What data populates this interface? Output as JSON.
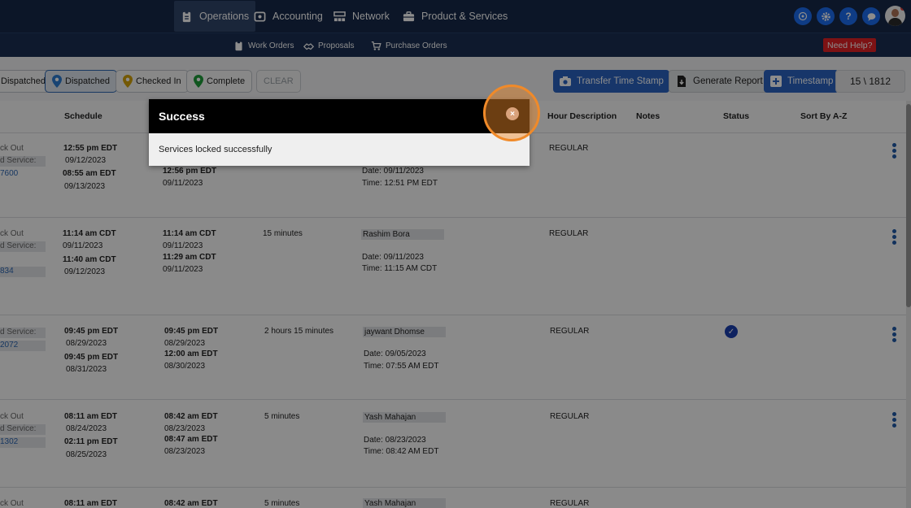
{
  "nav": {
    "items": [
      {
        "label": "Operations",
        "icon": "clipboard-icon"
      },
      {
        "label": "Accounting",
        "icon": "money-icon"
      },
      {
        "label": "Network",
        "icon": "network-icon"
      },
      {
        "label": "Product & Services",
        "icon": "briefcase-icon"
      }
    ],
    "right_icons": [
      "compass-icon",
      "gear-icon",
      "help-icon",
      "chat-icon"
    ],
    "help_glyph": "?"
  },
  "subnav": {
    "items": [
      {
        "label": "Work Orders",
        "icon": "clipboard-icon"
      },
      {
        "label": "Proposals",
        "icon": "handshake-icon"
      },
      {
        "label": "Purchase Orders",
        "icon": "cart-icon"
      }
    ],
    "help_label": "Need Help?"
  },
  "toolbar": {
    "filters": [
      {
        "label": "Dispatched",
        "pin_color": "#9aa3ad"
      },
      {
        "label": "Dispatched",
        "pin_color": "#2d7dd2"
      },
      {
        "label": "Checked In",
        "pin_color": "#d4a20a"
      },
      {
        "label": "Complete",
        "pin_color": "#1e9d3a"
      }
    ],
    "clear_label": "CLEAR",
    "transfer_label": "Transfer Time Stamp",
    "report_label": "Generate Report",
    "timestamp_label": "Timestamp",
    "counter": "15 \\ 1812"
  },
  "table": {
    "headers": {
      "schedule": "Schedule",
      "hour_description": "Hour Description",
      "notes": "Notes",
      "status": "Status",
      "sort": "Sort By A-Z"
    },
    "rows": [
      {
        "left": [
          "ck Out",
          "d Service:",
          "7600"
        ],
        "sched_start": "12:55 pm EDT",
        "sched_start_date": "09/12/2023",
        "sched_end": "08:55 am EDT",
        "sched_end_date": "09/13/2023",
        "act_start": "",
        "act_start_date": "",
        "act_end": "12:56 pm EDT",
        "act_end_date": "09/11/2023",
        "duration": "",
        "tech": "",
        "date": "Date: 09/11/2023",
        "time": "Time: 12:51 PM EDT",
        "hour": "REGULAR",
        "status_checked": false
      },
      {
        "left": [
          "ck Out",
          "d Service:",
          "834"
        ],
        "sched_start": "11:14 am CDT",
        "sched_start_date": "09/11/2023",
        "sched_end": "11:40 am CDT",
        "sched_end_date": "09/12/2023",
        "act_start": "11:14 am CDT",
        "act_start_date": "09/11/2023",
        "act_end": "11:29 am CDT",
        "act_end_date": "09/11/2023",
        "duration": "15 minutes",
        "tech": "Rashim Bora",
        "date": "Date: 09/11/2023",
        "time": "Time: 11:15 AM CDT",
        "hour": "REGULAR",
        "status_checked": false
      },
      {
        "left": [
          "",
          "d Service:",
          "2072"
        ],
        "sched_start": "09:45 pm EDT",
        "sched_start_date": "08/29/2023",
        "sched_end": "09:45 pm EDT",
        "sched_end_date": "08/31/2023",
        "act_start": "09:45 pm EDT",
        "act_start_date": "08/29/2023",
        "act_end": "12:00 am EDT",
        "act_end_date": "08/30/2023",
        "duration": "2 hours 15 minutes",
        "tech": "jaywant Dhomse",
        "date": "Date: 09/05/2023",
        "time": "Time: 07:55 AM EDT",
        "hour": "REGULAR",
        "status_checked": true
      },
      {
        "left": [
          "ck Out",
          "d Service:",
          "1302"
        ],
        "sched_start": "08:11 am EDT",
        "sched_start_date": "08/24/2023",
        "sched_end": "02:11 pm EDT",
        "sched_end_date": "08/25/2023",
        "act_start": "08:42 am EDT",
        "act_start_date": "08/23/2023",
        "act_end": "08:47 am EDT",
        "act_end_date": "08/23/2023",
        "duration": "5 minutes",
        "tech": "Yash Mahajan",
        "date": "Date: 08/23/2023",
        "time": "Time: 08:42 AM EDT",
        "hour": "REGULAR",
        "status_checked": false
      },
      {
        "left": [
          "ck Out",
          "",
          ""
        ],
        "sched_start": "08:11 am EDT",
        "sched_start_date": "",
        "sched_end": "",
        "sched_end_date": "",
        "act_start": "08:42 am EDT",
        "act_start_date": "",
        "act_end": "",
        "act_end_date": "",
        "duration": "5 minutes",
        "tech": "Yash Mahajan",
        "date": "",
        "time": "",
        "hour": "REGULAR",
        "status_checked": false
      }
    ]
  },
  "modal": {
    "title": "Success",
    "message": "Services locked successfully",
    "close_icon": "close-icon",
    "close_glyph": "×"
  }
}
